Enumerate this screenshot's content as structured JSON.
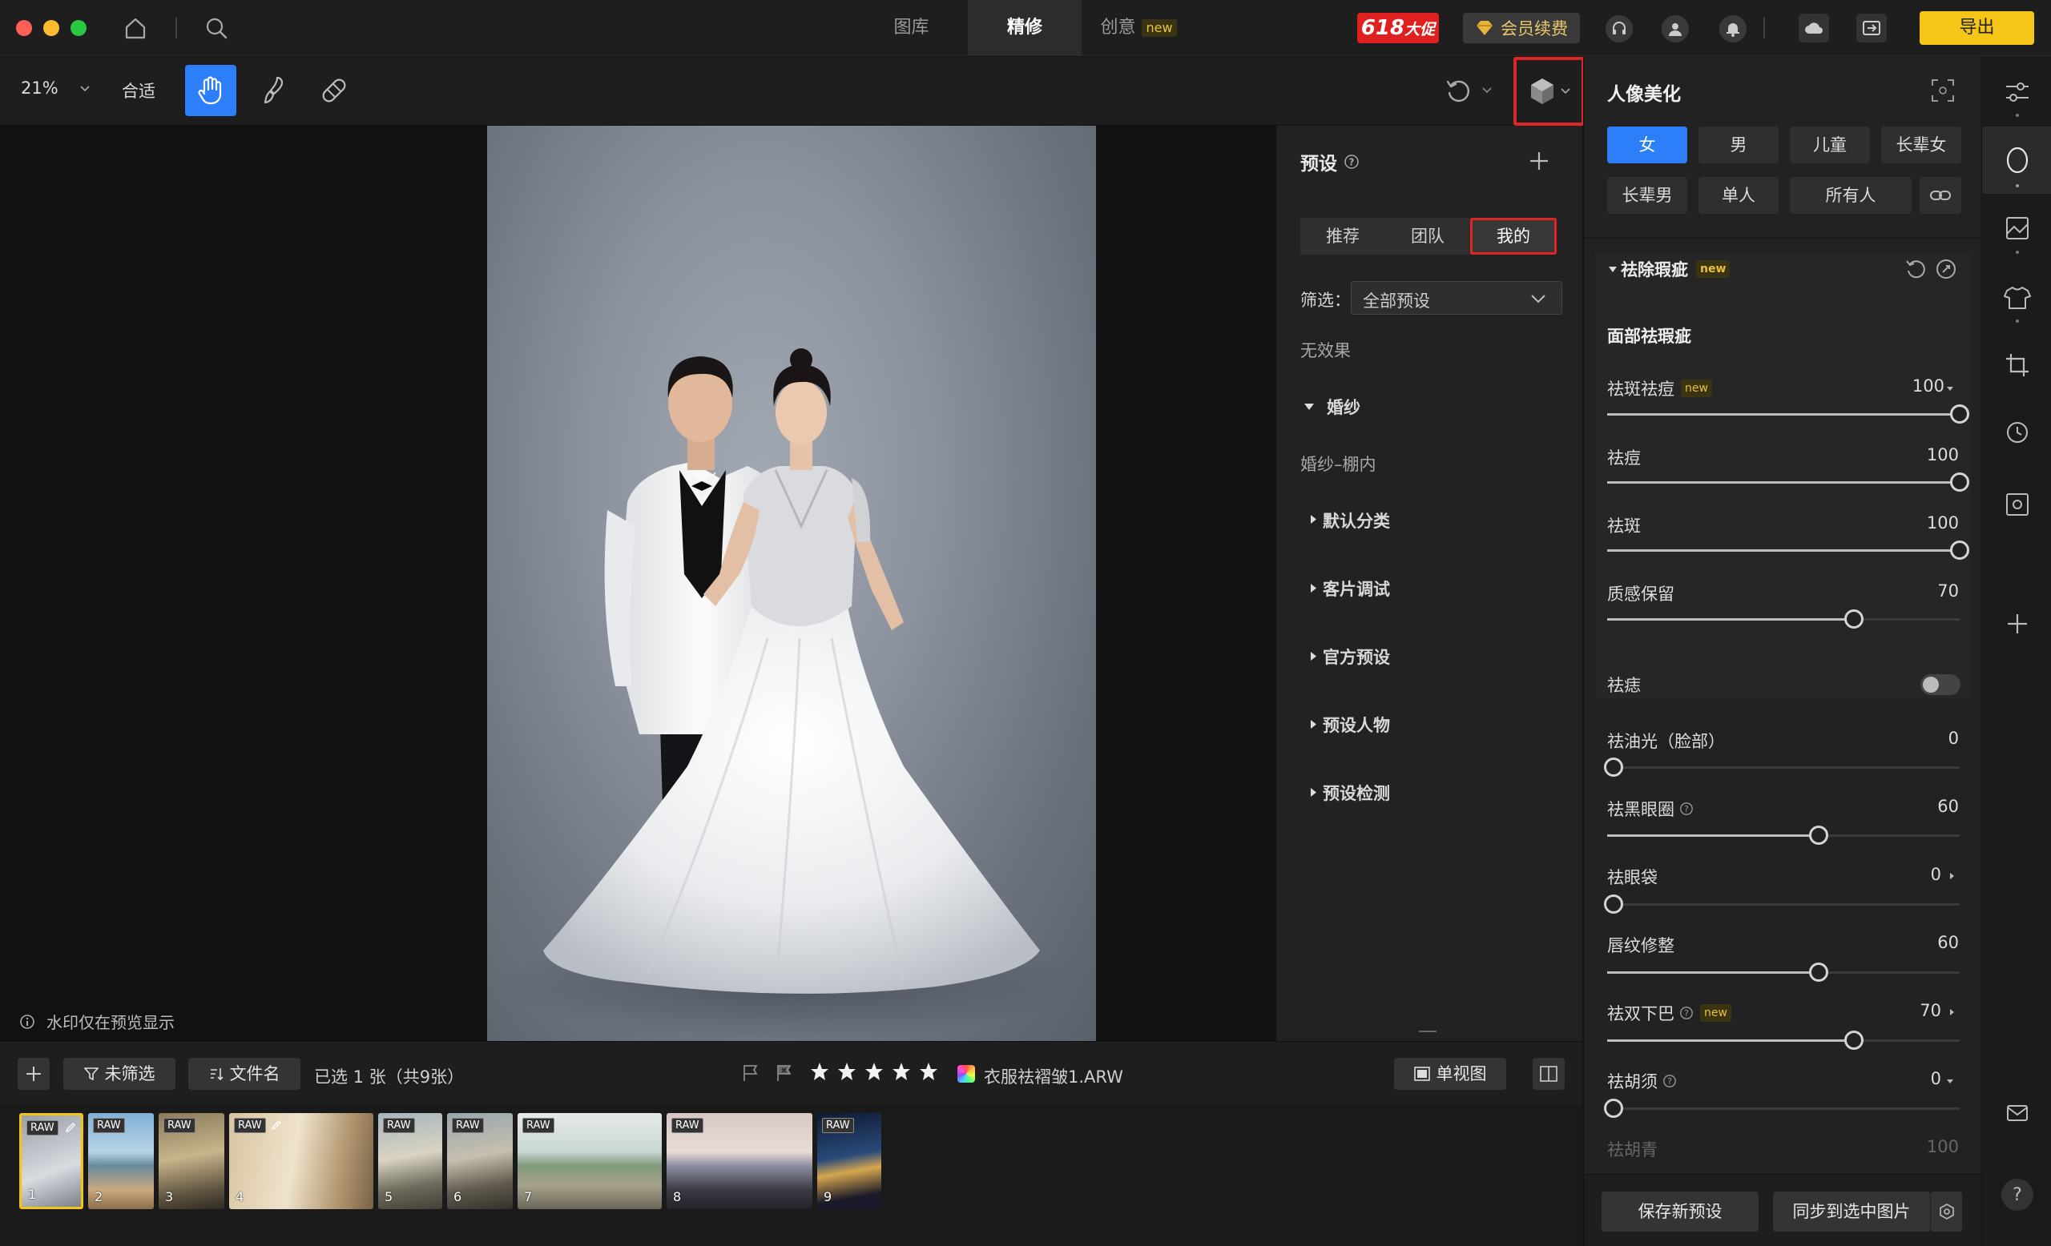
{
  "window": {
    "traffic": [
      "#ff5f57",
      "#febc2e",
      "#28c840"
    ]
  },
  "top_tabs": [
    {
      "label": "图库"
    },
    {
      "label": "精修"
    },
    {
      "label": "创意",
      "badge": "new"
    }
  ],
  "top_right": {
    "promo": "618",
    "promo_suffix": "大促",
    "member_label": "会员续费",
    "export_label": "导出"
  },
  "toolbar": {
    "zoom": "21%",
    "fit_label": "合适"
  },
  "canvas": {
    "watermark_note": "水印仅在预览显示"
  },
  "presets": {
    "title": "预设",
    "tabs": [
      "推荐",
      "团队",
      "我的"
    ],
    "active_tab": 2,
    "filter_label": "筛选：",
    "filter_value": "全部预设",
    "no_effect": "无效果",
    "group_name": "婚纱",
    "subgroup": "婚纱–棚内",
    "categories": [
      "默认分类",
      "客片调试",
      "官方预设",
      "预设人物",
      "预设检测"
    ]
  },
  "portrait": {
    "title": "人像美化",
    "chips_row1": [
      "女",
      "男",
      "儿童",
      "长辈女"
    ],
    "chips_row2": [
      "长辈男",
      "单人",
      "所有人"
    ],
    "active_chip": 0,
    "section_title": "祛除瑕疵",
    "section_badge": "new",
    "sub_title": "面部祛瑕疵",
    "sliders": [
      {
        "label": "祛斑祛痘",
        "badge": "new",
        "value": "100",
        "level": 1.0,
        "caret": "down"
      },
      {
        "label": "祛痘",
        "value": "100",
        "level": 1.0
      },
      {
        "label": "祛斑",
        "value": "100",
        "level": 1.0
      },
      {
        "label": "质感保留",
        "value": "70",
        "level": 0.7
      }
    ],
    "toggle_label": "祛痣",
    "sliders2": [
      {
        "label": "祛油光（脸部）",
        "value": "0",
        "level": 0.0
      },
      {
        "label": "祛黑眼圈",
        "value": "60",
        "level": 0.6,
        "help": true
      },
      {
        "label": "祛眼袋",
        "value": "0",
        "level": 0.0,
        "caret": "right"
      },
      {
        "label": "唇纹修整",
        "value": "60",
        "level": 0.6
      },
      {
        "label": "祛双下巴",
        "value": "70",
        "level": 0.7,
        "help": true,
        "badge": "new",
        "caret": "right"
      },
      {
        "label": "祛胡须",
        "value": "0",
        "level": 0.0,
        "help": true,
        "caret": "down"
      }
    ],
    "faded_label": "祛胡青",
    "faded_value": "100",
    "save_preset": "保存新预设",
    "sync_label": "同步到选中图片"
  },
  "bottom": {
    "filter_label": "未筛选",
    "sort_label": "文件名",
    "selection": "已选 1 张（共9张）",
    "filename": "衣服祛褶皱1.ARW",
    "single_view": "单视图"
  },
  "thumbnails": [
    {
      "num": "1",
      "raw": "RAW"
    },
    {
      "num": "2",
      "raw": "RAW"
    },
    {
      "num": "3",
      "raw": "RAW"
    },
    {
      "num": "4",
      "raw": "RAW"
    },
    {
      "num": "5",
      "raw": "RAW"
    },
    {
      "num": "6",
      "raw": "RAW"
    },
    {
      "num": "7",
      "raw": "RAW"
    },
    {
      "num": "8",
      "raw": "RAW"
    },
    {
      "num": "9",
      "raw": "RAW"
    }
  ]
}
